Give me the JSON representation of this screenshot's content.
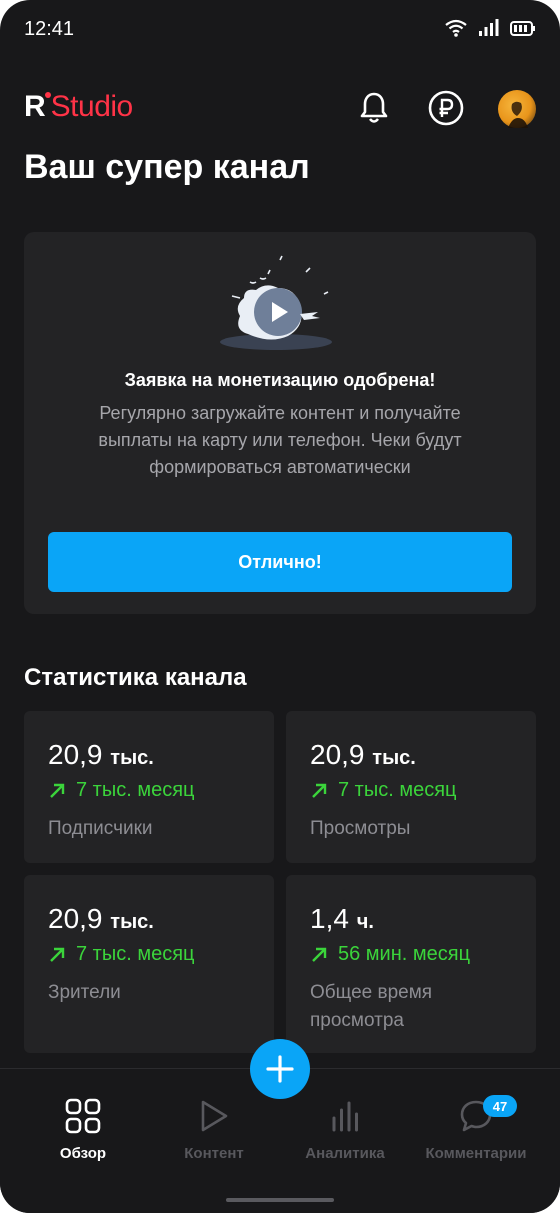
{
  "status_bar": {
    "time": "12:41"
  },
  "header": {
    "logo_letter": "R",
    "logo_text": "Studio"
  },
  "page_title": "Ваш супер канал",
  "monetization": {
    "heading": "Заявка на монетизацию одобрена!",
    "text": "Регулярно загружайте контент и получайте выплаты на карту или телефон. Чеки будут формироваться автоматически",
    "button_label": "Отлично!"
  },
  "stats": {
    "title": "Статистика канала",
    "cards": [
      {
        "value": "20,9",
        "unit": "тыс.",
        "delta": "7 тыс. месяц",
        "label": "Подписчики"
      },
      {
        "value": "20,9",
        "unit": "тыс.",
        "delta": "7 тыс. месяц",
        "label": "Просмотры"
      },
      {
        "value": "20,9",
        "unit": "тыс.",
        "delta": "7 тыс. месяц",
        "label": "Зрители"
      },
      {
        "value": "1,4",
        "unit": "ч.",
        "delta": "56 мин. месяц",
        "label": "Общее время просмотра"
      }
    ]
  },
  "nav": {
    "items": [
      {
        "label": "Обзор",
        "icon": "grid-icon",
        "active": true
      },
      {
        "label": "Контент",
        "icon": "play-icon",
        "active": false
      },
      {
        "label": "Аналитика",
        "icon": "bar-chart-icon",
        "active": false
      },
      {
        "label": "Комментарии",
        "icon": "comment-icon",
        "active": false,
        "badge": "47"
      }
    ]
  },
  "colors": {
    "accent": "#0aa5f7",
    "brand": "#ff3347",
    "positive": "#3bd43b",
    "background": "#18181a",
    "card": "#232325"
  }
}
